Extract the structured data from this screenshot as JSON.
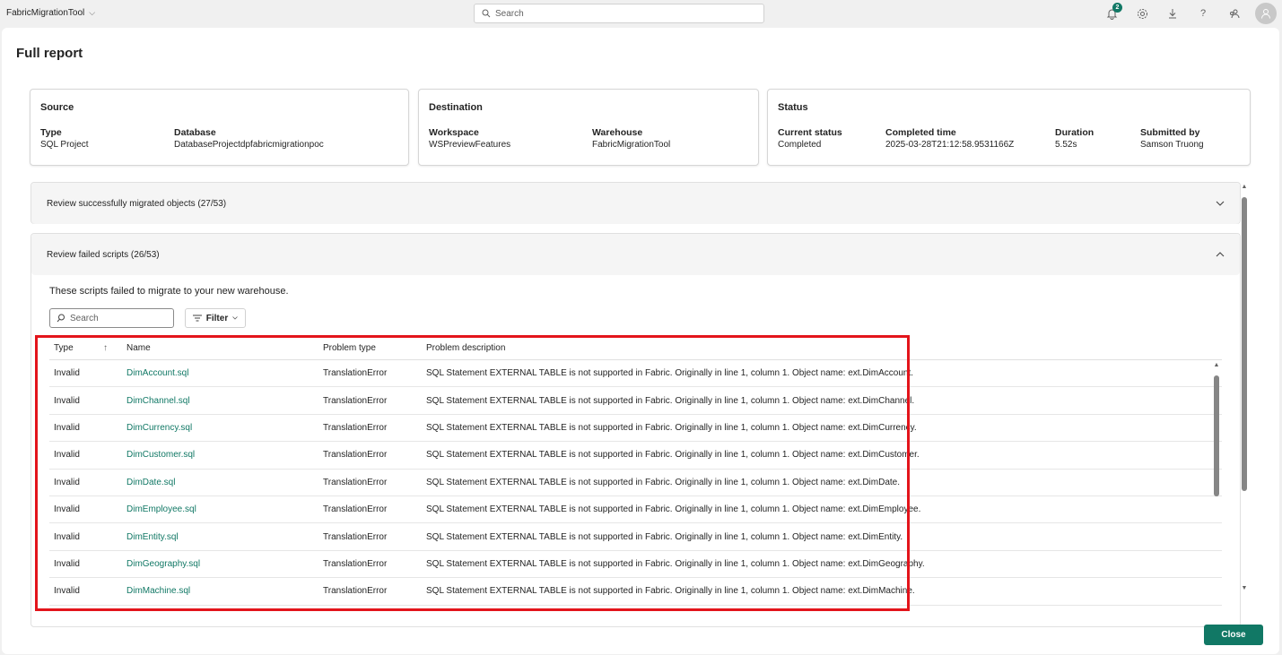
{
  "topbar": {
    "app_name": "FabricMigrationTool",
    "search_placeholder": "Search",
    "notification_count": "2"
  },
  "dialog": {
    "title": "Full report",
    "close_label": "Close"
  },
  "source": {
    "title": "Source",
    "type_label": "Type",
    "type_value": "SQL Project",
    "database_label": "Database",
    "database_value": "DatabaseProjectdpfabricmigrationpoc"
  },
  "destination": {
    "title": "Destination",
    "workspace_label": "Workspace",
    "workspace_value": "WSPreviewFeatures",
    "warehouse_label": "Warehouse",
    "warehouse_value": "FabricMigrationTool"
  },
  "status": {
    "title": "Status",
    "current_label": "Current status",
    "current_value": "Completed",
    "completed_label": "Completed time",
    "completed_value": "2025-03-28T21:12:58.9531166Z",
    "duration_label": "Duration",
    "duration_value": "5.52s",
    "submitted_label": "Submitted by",
    "submitted_value": "Samson Truong"
  },
  "accordion_success": {
    "label": "Review successfully migrated objects (27/53)"
  },
  "accordion_failed": {
    "label": "Review failed scripts (26/53)",
    "description": "These scripts failed to migrate to your new warehouse.",
    "search_placeholder": "Search",
    "filter_label": "Filter"
  },
  "table": {
    "headers": {
      "type": "Type",
      "name": "Name",
      "problem_type": "Problem type",
      "problem_description": "Problem description"
    },
    "rows": [
      {
        "type": "Invalid",
        "name": "DimAccount.sql",
        "problem_type": "TranslationError",
        "description": "SQL Statement EXTERNAL TABLE is not supported in Fabric. Originally in line 1, column 1. Object name: ext.DimAccount."
      },
      {
        "type": "Invalid",
        "name": "DimChannel.sql",
        "problem_type": "TranslationError",
        "description": "SQL Statement EXTERNAL TABLE is not supported in Fabric. Originally in line 1, column 1. Object name: ext.DimChannel."
      },
      {
        "type": "Invalid",
        "name": "DimCurrency.sql",
        "problem_type": "TranslationError",
        "description": "SQL Statement EXTERNAL TABLE is not supported in Fabric. Originally in line 1, column 1. Object name: ext.DimCurrency."
      },
      {
        "type": "Invalid",
        "name": "DimCustomer.sql",
        "problem_type": "TranslationError",
        "description": "SQL Statement EXTERNAL TABLE is not supported in Fabric. Originally in line 1, column 1. Object name: ext.DimCustomer."
      },
      {
        "type": "Invalid",
        "name": "DimDate.sql",
        "problem_type": "TranslationError",
        "description": "SQL Statement EXTERNAL TABLE is not supported in Fabric. Originally in line 1, column 1. Object name: ext.DimDate."
      },
      {
        "type": "Invalid",
        "name": "DimEmployee.sql",
        "problem_type": "TranslationError",
        "description": "SQL Statement EXTERNAL TABLE is not supported in Fabric. Originally in line 1, column 1. Object name: ext.DimEmployee."
      },
      {
        "type": "Invalid",
        "name": "DimEntity.sql",
        "problem_type": "TranslationError",
        "description": "SQL Statement EXTERNAL TABLE is not supported in Fabric. Originally in line 1, column 1. Object name: ext.DimEntity."
      },
      {
        "type": "Invalid",
        "name": "DimGeography.sql",
        "problem_type": "TranslationError",
        "description": "SQL Statement EXTERNAL TABLE is not supported in Fabric. Originally in line 1, column 1. Object name: ext.DimGeography."
      },
      {
        "type": "Invalid",
        "name": "DimMachine.sql",
        "problem_type": "TranslationError",
        "description": "SQL Statement EXTERNAL TABLE is not supported in Fabric. Originally in line 1, column 1. Object name: ext.DimMachine."
      }
    ]
  },
  "colors": {
    "accent": "#117865",
    "highlight_frame": "#e3141b"
  }
}
